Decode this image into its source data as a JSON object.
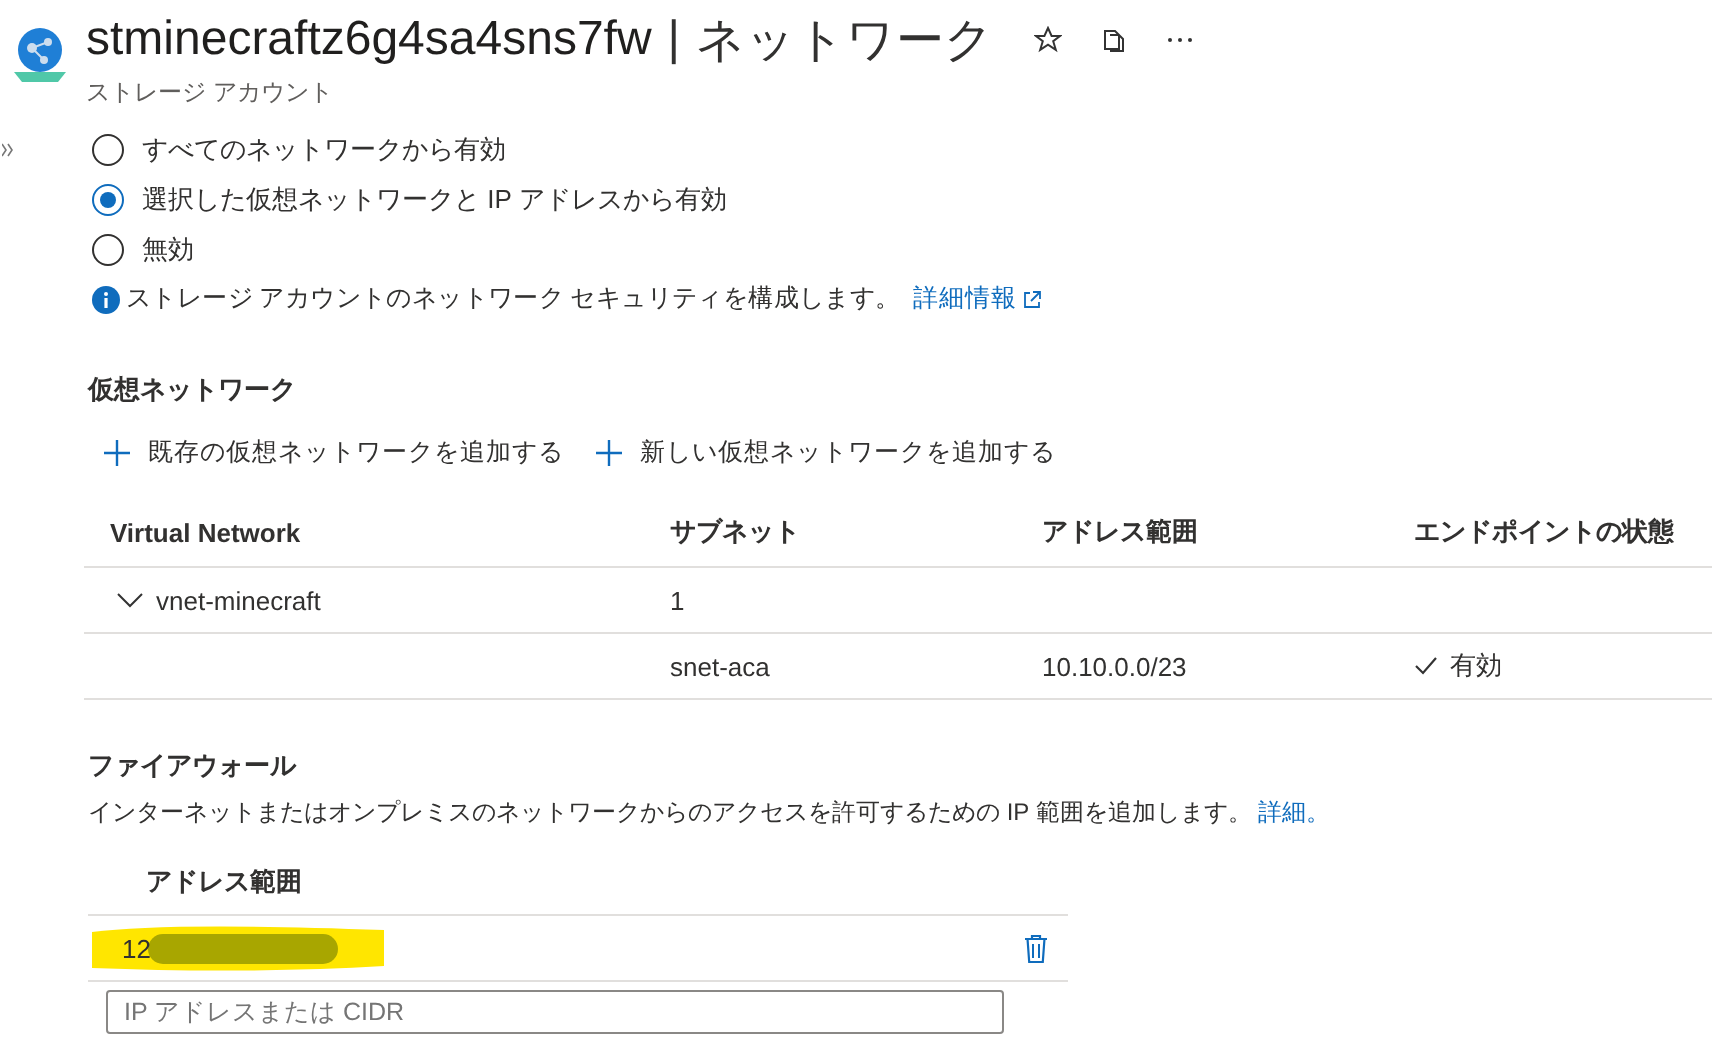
{
  "header": {
    "title": "stminecraftz6g4sa4sns7fw",
    "separator": "|",
    "page": "ネットワーク",
    "subtitle": "ストレージ アカウント"
  },
  "access_options": [
    {
      "label": "すべてのネットワークから有効",
      "selected": false
    },
    {
      "label": "選択した仮想ネットワークと IP アドレスから有効",
      "selected": true
    },
    {
      "label": "無効",
      "selected": false
    }
  ],
  "info": {
    "text": "ストレージ アカウントのネットワーク セキュリティを構成します。",
    "link": "詳細情報"
  },
  "virtual_networks": {
    "heading": "仮想ネットワーク",
    "actions": [
      "既存の仮想ネットワークを追加する",
      "新しい仮想ネットワークを追加する"
    ],
    "columns": [
      "Virtual Network",
      "サブネット",
      "アドレス範囲",
      "エンドポイントの状態"
    ],
    "rows": [
      {
        "kind": "network",
        "name": "vnet-minecraft",
        "subnet_count": "1",
        "expanded": true
      },
      {
        "kind": "subnet",
        "subnet": "snet-aca",
        "address_range": "10.10.0.0/23",
        "status": "有効"
      }
    ]
  },
  "firewall": {
    "heading": "ファイアウォール",
    "description": "インターネットまたはオンプレミスのネットワークからのアクセスを許可するための IP 範囲を追加します。",
    "link": "詳細。",
    "column": "アドレス範囲",
    "rows": [
      {
        "address": "12"
      }
    ],
    "input": {
      "placeholder": "IP アドレスまたは CIDR"
    }
  }
}
